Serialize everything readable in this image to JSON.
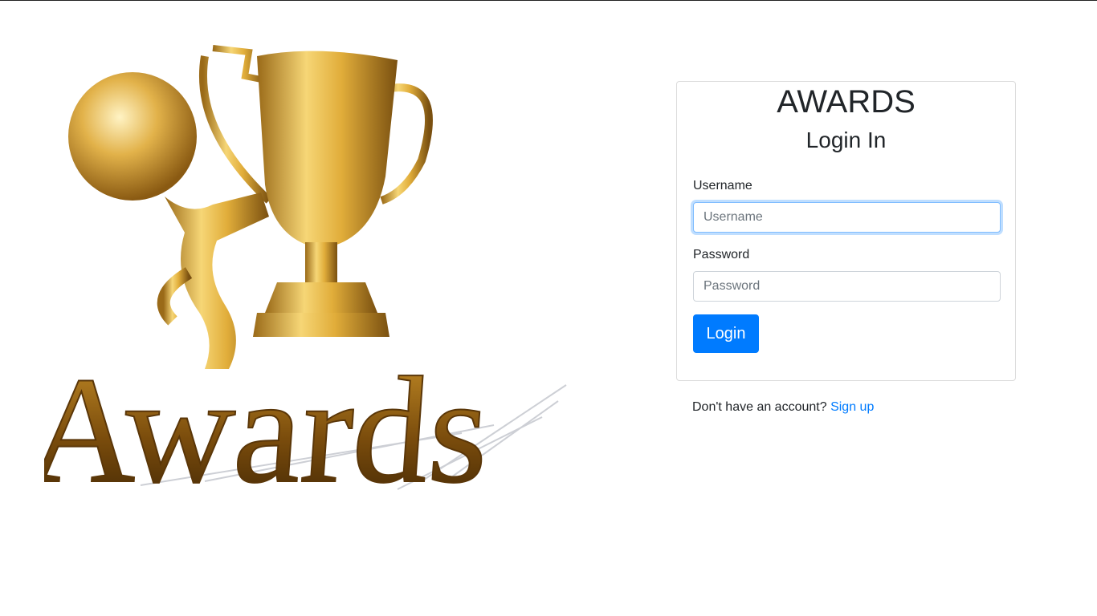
{
  "hero": {
    "image_name": "awards-trophy-figure",
    "word": "Awards"
  },
  "card": {
    "brand": "AWARDS",
    "subtitle": "Login In",
    "username_label": "Username",
    "username_placeholder": "Username",
    "username_value": "",
    "password_label": "Password",
    "password_placeholder": "Password",
    "password_value": "",
    "login_label": "Login"
  },
  "signup": {
    "prompt": "Don't have an account?",
    "link_label": "Sign up"
  },
  "colors": {
    "primary": "#007bff",
    "gold": "#d4a437",
    "text": "#212529",
    "border": "#dcdcdc"
  }
}
